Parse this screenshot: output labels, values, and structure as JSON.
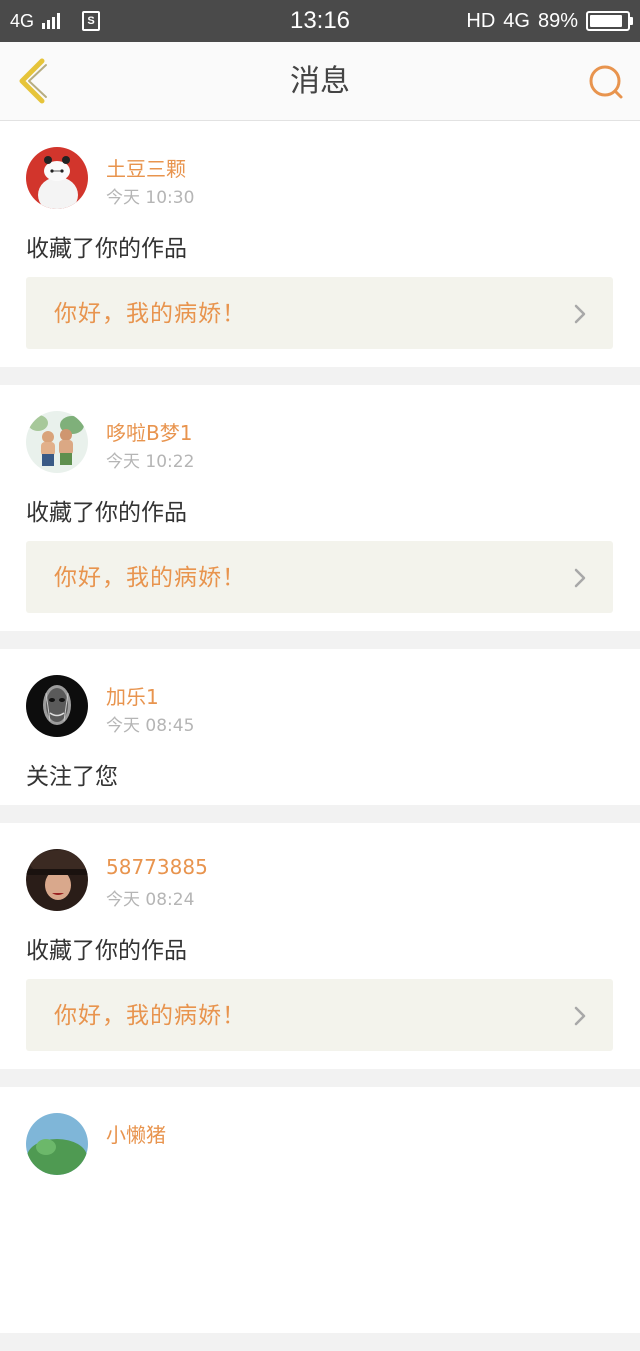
{
  "status_bar": {
    "network_left": "4G",
    "time": "13:16",
    "hd": "HD",
    "network_right": "4G",
    "battery": "89%",
    "battery_level": 0.89
  },
  "header": {
    "title": "消息",
    "back_icon": "chevron-left-icon",
    "search_icon": "search-icon"
  },
  "notifications": [
    {
      "user": "土豆三颗",
      "time": "今天 10:30",
      "action": "收藏了你的作品",
      "preview": "你好，我的病娇！"
    },
    {
      "user": "哆啦B梦1",
      "time": "今天 10:22",
      "action": "收藏了你的作品",
      "preview": "你好，我的病娇！"
    },
    {
      "user": "加乐1",
      "time": "今天 08:45",
      "action": "关注了您"
    },
    {
      "user": "58773885",
      "time": "今天 08:24",
      "action": "收藏了你的作品",
      "preview": "你好，我的病娇！"
    },
    {
      "user": "小懒猪"
    }
  ],
  "colors": {
    "accent": "#e8944e",
    "back_arrow": "#e6c43a",
    "status_bar": "#4a4a4a",
    "preview_bg": "#f3f3ec"
  }
}
